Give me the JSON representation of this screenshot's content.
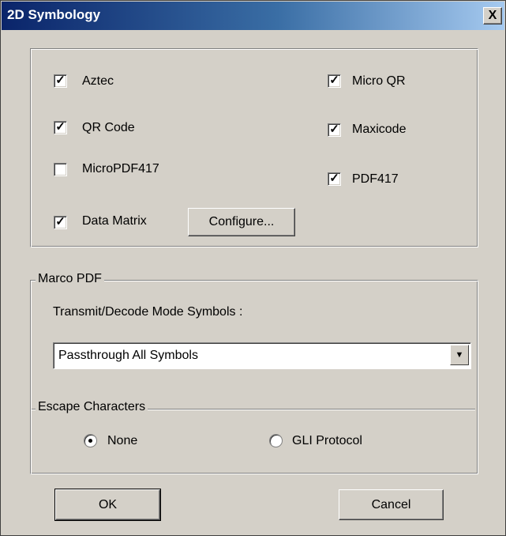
{
  "window": {
    "title": "2D Symbology",
    "close_label": "X"
  },
  "symbologies": [
    {
      "label": "Aztec",
      "checked": true
    },
    {
      "label": "QR Code",
      "checked": true
    },
    {
      "label": "MicroPDF417",
      "checked": false
    },
    {
      "label": "Data Matrix",
      "checked": true
    },
    {
      "label": "Micro QR",
      "checked": true
    },
    {
      "label": "Maxicode",
      "checked": true
    },
    {
      "label": "PDF417",
      "checked": true
    }
  ],
  "configure_button": "Configure...",
  "macro_pdf": {
    "group_label": "Marco PDF",
    "mode_label": "Transmit/Decode Mode Symbols :",
    "mode_value": "Passthrough All Symbols",
    "escape_label": "Escape Characters",
    "options": [
      {
        "label": "None",
        "selected": true
      },
      {
        "label": "GLI Protocol",
        "selected": false
      }
    ]
  },
  "buttons": {
    "ok": "OK",
    "cancel": "Cancel"
  }
}
